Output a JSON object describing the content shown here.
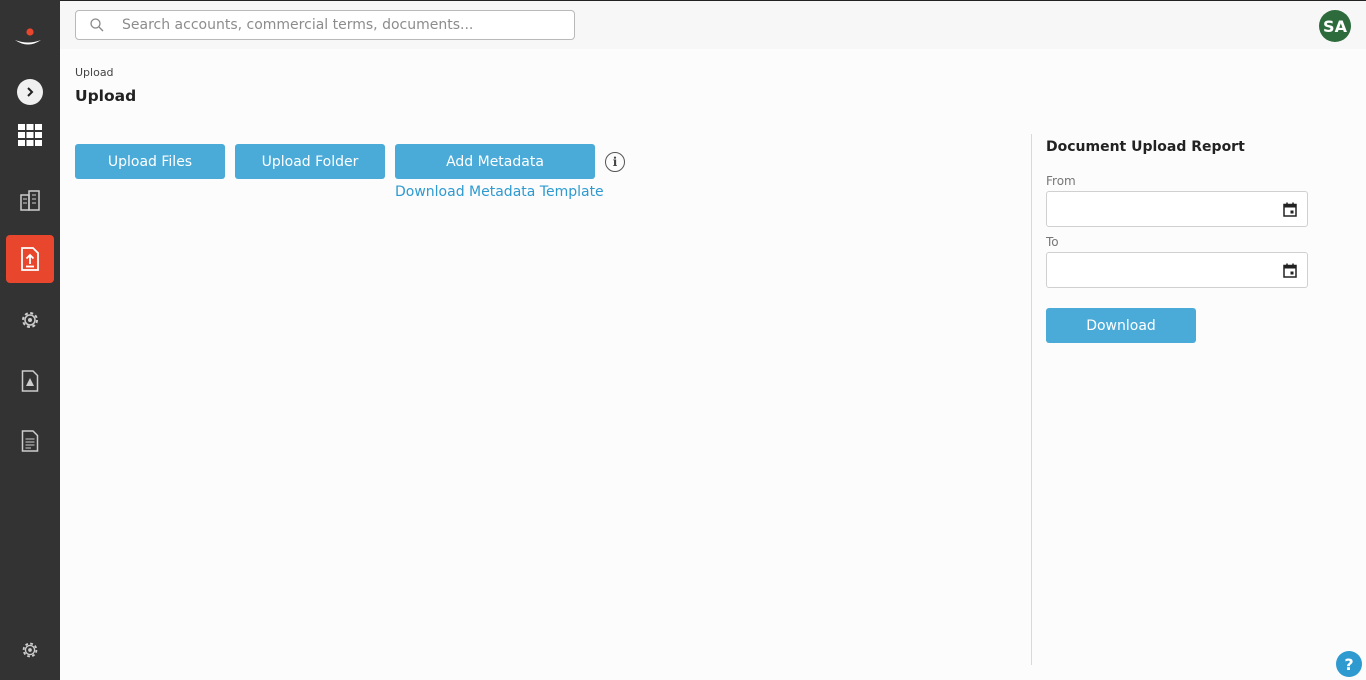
{
  "search": {
    "placeholder": "Search accounts, commercial terms, documents..."
  },
  "user": {
    "initials": "SA"
  },
  "breadcrumb": "Upload",
  "page_title": "Upload",
  "actions": {
    "upload_files": "Upload Files",
    "upload_folder": "Upload Folder",
    "add_metadata": "Add Metadata",
    "info_glyph": "i",
    "download_template": "Download Metadata Template"
  },
  "report": {
    "title": "Document Upload Report",
    "from_label": "From",
    "to_label": "To",
    "download_label": "Download"
  },
  "help_glyph": "?",
  "sidebar": {
    "items": [
      "logo",
      "expand",
      "apps-grid",
      "accounts",
      "upload",
      "settings-gear",
      "alert-document",
      "report-document",
      "admin-settings"
    ],
    "active": "upload"
  },
  "colors": {
    "accent": "#4aabd8",
    "sidebar": "#333333",
    "active": "#e8472d",
    "link": "#2e9ad0",
    "avatar": "#2e6b3c"
  }
}
